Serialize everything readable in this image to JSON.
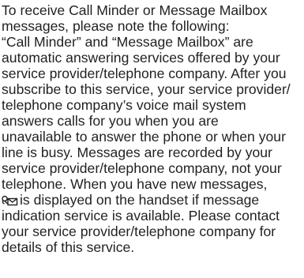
{
  "document": {
    "lines": [
      "To receive Call Minder or Message Mailbox",
      "messages, please note the following:",
      "“Call Minder” and “Message Mailbox” are",
      "automatic answering services offered by your",
      "service provider/telephone company. After you",
      "subscribe to this service, your service provider/",
      "telephone company’s voice mail system",
      "answers calls for you when you are",
      "unavailable to answer the phone or when your",
      "line is busy. Messages are recorded by your",
      "service provider/telephone company, not your",
      "telephone. When you have new messages,",
      "is displayed on the handset if message",
      "indication service is available. Please contact",
      "your service provider/telephone company for",
      "details of this service."
    ],
    "message_icon": "voicemail-message-icon"
  }
}
